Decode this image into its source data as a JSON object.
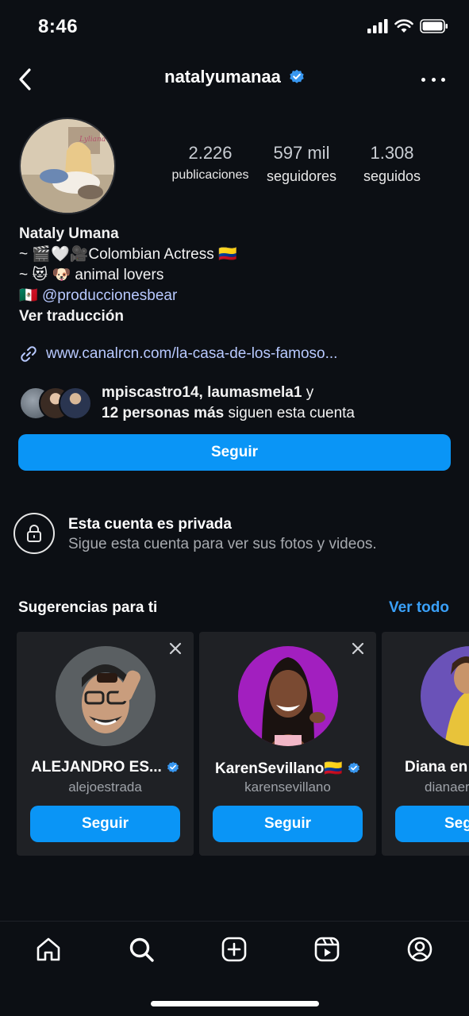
{
  "status_bar": {
    "time": "8:46"
  },
  "header": {
    "handle": "natalyumanaa"
  },
  "stats": [
    {
      "value": "2.226",
      "label": "publicaciones"
    },
    {
      "value": "597 mil",
      "label": "seguidores"
    },
    {
      "value": "1.308",
      "label": "seguidos"
    }
  ],
  "bio": {
    "name": "Nataly Umana",
    "line1": "~ 🎬🤍🎥Colombian Actress 🇨🇴",
    "line2": "~ 😻 🐶 animal lovers",
    "line3_flag": "🇲🇽",
    "line3_mention": "@produccionesbear",
    "translate": "Ver traducción"
  },
  "link": {
    "text": "www.canalrcn.com/la-casa-de-los-famoso..."
  },
  "mutual": {
    "names": "mpiscastro14, laumasmela1",
    "connector": " y",
    "count": "12 personas más",
    "suffix": " siguen esta cuenta"
  },
  "follow_button": {
    "label": "Seguir"
  },
  "private": {
    "title": "Esta cuenta es privada",
    "subtitle": "Sigue esta cuenta para ver sus fotos y videos."
  },
  "suggestions": {
    "title": "Sugerencias para ti",
    "see_all": "Ver todo",
    "cards": [
      {
        "name": "ALEJANDRO ES...",
        "username": "alejoestrada",
        "button": "Seguir"
      },
      {
        "name": "KarenSevillano🇨🇴",
        "username": "karensevillano",
        "button": "Seguir"
      },
      {
        "name": "Diana en",
        "username": "dianaer",
        "button": "Seg"
      }
    ]
  },
  "colors": {
    "accent": "#0a95f6",
    "link": "#3aa0f8",
    "background": "#0c0f14",
    "card": "#1f2125"
  },
  "nav": [
    "home-icon",
    "search-icon",
    "create-icon",
    "reels-icon",
    "profile-icon"
  ]
}
